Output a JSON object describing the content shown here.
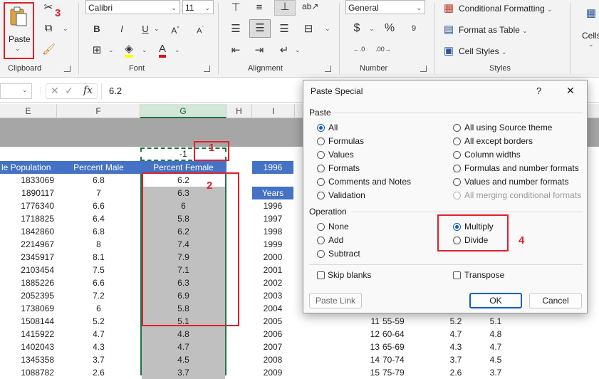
{
  "ribbon": {
    "clipboard": {
      "paste_label": "Paste",
      "group_label": "Clipboard"
    },
    "font": {
      "font_name": "Calibri",
      "font_size": "11",
      "group_label": "Font",
      "bold": "B",
      "italic": "I",
      "underline": "U"
    },
    "alignment": {
      "group_label": "Alignment"
    },
    "number": {
      "format": "General",
      "group_label": "Number",
      "currency": "$",
      "percent": "%"
    },
    "styles": {
      "conditional_formatting": "Conditional Formatting",
      "format_as_table": "Format as Table",
      "cell_styles": "Cell Styles",
      "group_label": "Styles"
    },
    "cells": {
      "label": "Cells"
    }
  },
  "formula_bar": {
    "fx": "fx",
    "value": "6.2"
  },
  "columns": [
    "E",
    "F",
    "G",
    "H",
    "I"
  ],
  "annotations": {
    "n1": "1",
    "n2": "2",
    "n3": "3",
    "n4": "4"
  },
  "sheet": {
    "g_top_value": "-1",
    "headers": {
      "e": "le Population",
      "f": "Percent Male",
      "g": "Percent Female",
      "i": "1996"
    },
    "years_label": "Years",
    "rows": [
      {
        "e": "1833069",
        "f": "6.8",
        "g": "6.2",
        "i": ""
      },
      {
        "e": "1890117",
        "f": "7",
        "g": "6.3",
        "i": ""
      },
      {
        "e": "1776340",
        "f": "6.6",
        "g": "6",
        "i": "1996"
      },
      {
        "e": "1718825",
        "f": "6.4",
        "g": "5.8",
        "i": "1997"
      },
      {
        "e": "1842860",
        "f": "6.8",
        "g": "6.2",
        "i": "1998"
      },
      {
        "e": "2214967",
        "f": "8",
        "g": "7.4",
        "i": "1999"
      },
      {
        "e": "2345917",
        "f": "8.1",
        "g": "7.9",
        "i": "2000"
      },
      {
        "e": "2103454",
        "f": "7.5",
        "g": "7.1",
        "i": "2001"
      },
      {
        "e": "1885226",
        "f": "6.6",
        "g": "6.3",
        "i": "2002"
      },
      {
        "e": "2052395",
        "f": "7.2",
        "g": "6.9",
        "i": "2003"
      },
      {
        "e": "1738069",
        "f": "6",
        "g": "5.8",
        "i": "2004"
      },
      {
        "e": "1508144",
        "f": "5.2",
        "g": "5.1",
        "i": "2005"
      },
      {
        "e": "1415922",
        "f": "4.7",
        "g": "4.8",
        "i": "2006"
      },
      {
        "e": "1402043",
        "f": "4.3",
        "g": "4.7",
        "i": "2007"
      },
      {
        "e": "1345358",
        "f": "3.7",
        "g": "4.5",
        "i": "2008"
      },
      {
        "e": "1088782",
        "f": "2.6",
        "g": "3.7",
        "i": "2009"
      }
    ],
    "side_rows": [
      {
        "n": "11",
        "age": "55-59",
        "m": "5.2",
        "f": "5.1"
      },
      {
        "n": "12",
        "age": "60-64",
        "m": "4.7",
        "f": "4.8"
      },
      {
        "n": "13",
        "age": "65-69",
        "m": "4.3",
        "f": "4.7"
      },
      {
        "n": "14",
        "age": "70-74",
        "m": "3.7",
        "f": "4.5"
      },
      {
        "n": "15",
        "age": "75-79",
        "m": "2.6",
        "f": "3.7"
      }
    ]
  },
  "dialog": {
    "title": "Paste Special",
    "help": "?",
    "close": "✕",
    "paste_section": "Paste",
    "paste_options_left": [
      "All",
      "Formulas",
      "Values",
      "Formats",
      "Comments and Notes",
      "Validation"
    ],
    "paste_options_right": [
      "All using Source theme",
      "All except borders",
      "Column widths",
      "Formulas and number formats",
      "Values and number formats",
      "All merging conditional formats"
    ],
    "operation_section": "Operation",
    "operation_left": [
      "None",
      "Add",
      "Subtract"
    ],
    "operation_right": [
      "Multiply",
      "Divide"
    ],
    "skip_blanks": "Skip blanks",
    "transpose": "Transpose",
    "paste_link": "Paste Link",
    "ok": "OK",
    "cancel": "Cancel"
  },
  "colors": {
    "accent_blue": "#4472c4",
    "selection_gray": "#c0c0c0",
    "annotation_red": "#e0202a",
    "selection_green": "#217346"
  }
}
